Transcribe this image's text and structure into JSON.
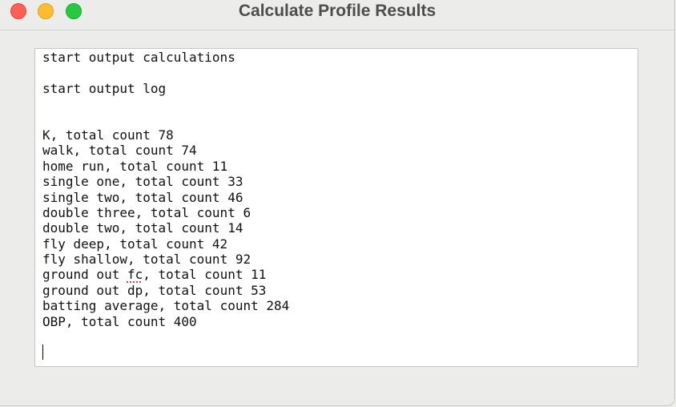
{
  "window": {
    "title": "Calculate Profile Results"
  },
  "output": {
    "header_calc": "start output calculations",
    "header_log": "start output log",
    "results": [
      {
        "label": "K",
        "count": "78"
      },
      {
        "label": "walk",
        "count": "74"
      },
      {
        "label": "home run",
        "count": "11"
      },
      {
        "label": "single one",
        "count": "33"
      },
      {
        "label": "single two",
        "count": "46"
      },
      {
        "label": "double three",
        "count": "6"
      },
      {
        "label": "double two",
        "count": "14"
      },
      {
        "label": "fly deep",
        "count": "42"
      },
      {
        "label": "fly shallow",
        "count": "92"
      },
      {
        "label": "ground out fc",
        "count": "11"
      },
      {
        "label": "ground out dp",
        "count": "53"
      },
      {
        "label": "batting average",
        "count": "284"
      },
      {
        "label": "OBP",
        "count": "400"
      }
    ],
    "count_prefix": ", total count "
  },
  "colors": {
    "close": "#fe5f57",
    "minimize": "#febc2e",
    "zoom": "#28c840",
    "spellcheck": "#e0443e"
  }
}
